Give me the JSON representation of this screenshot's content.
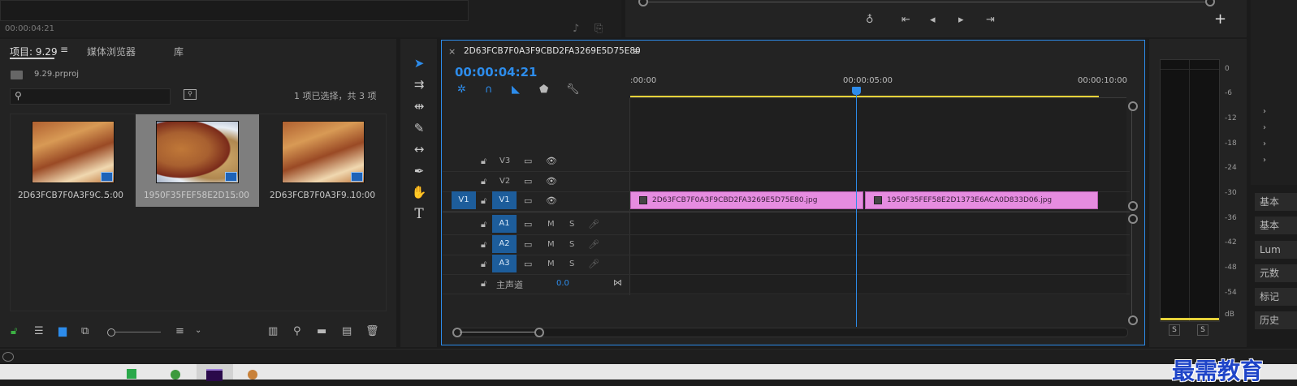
{
  "top_left": {
    "timecode": "00:00:04:21"
  },
  "project_panel": {
    "tabs": [
      {
        "label": "项目: 9.29",
        "active": true
      },
      {
        "label": "媒体浏览器",
        "active": false
      },
      {
        "label": "库",
        "active": false
      }
    ],
    "project_file": "9.29.prproj",
    "search_placeholder": "",
    "selection_status": "1 项已选择，共 3 项",
    "items": [
      {
        "name": "2D63FCB7F0A3F9C...",
        "duration": "5:00",
        "selected": false
      },
      {
        "name": "1950F35FEF58E2D1...",
        "duration": "5:00",
        "selected": true
      },
      {
        "name": "2D63FCB7F0A3F9...",
        "duration": "10:00",
        "selected": false
      }
    ]
  },
  "sequence": {
    "tab_title": "2D63FCB7F0A3F9CBD2FA3269E5D75E80",
    "close_glyph": "×",
    "menu_glyph": "≡",
    "timecode": "00:00:04:21",
    "ruler_labels": [
      ":00:00",
      "00:00:05:00",
      "00:00:10:00"
    ],
    "video_tracks": [
      {
        "source": "",
        "name": "V3"
      },
      {
        "source": "",
        "name": "V2"
      },
      {
        "source": "V1",
        "name": "V1"
      }
    ],
    "audio_tracks": [
      {
        "name": "A1",
        "m": "M",
        "s": "S"
      },
      {
        "name": "A2",
        "m": "M",
        "s": "S"
      },
      {
        "name": "A3",
        "m": "M",
        "s": "S"
      }
    ],
    "master": {
      "label": "主声道",
      "value": "0.0"
    },
    "clips": [
      {
        "name": "2D63FCB7F0A3F9CBD2FA3269E5D75E80.jpg",
        "start": 0,
        "end": 4.97
      },
      {
        "name": "1950F35FEF58E2D1373E6ACA0D833D06.jpg",
        "start": 5.03,
        "end": 10.0
      }
    ],
    "playhead_time": 4.84
  },
  "audio_meter": {
    "scale": [
      "0",
      "-6",
      "-12",
      "-18",
      "-24",
      "-30",
      "-36",
      "-42",
      "-48",
      "-54",
      "dB"
    ],
    "solo_labels": [
      "S",
      "S"
    ]
  },
  "right_side": {
    "buttons": [
      "基本",
      "基本",
      "Lum",
      "元数",
      "标记",
      "历史"
    ]
  },
  "watermark": "最需教育",
  "colors": {
    "accent": "#2d8ceb",
    "clip": "#e68ce0",
    "track_target": "#1d5d9b",
    "work_area": "#e6d23a"
  }
}
